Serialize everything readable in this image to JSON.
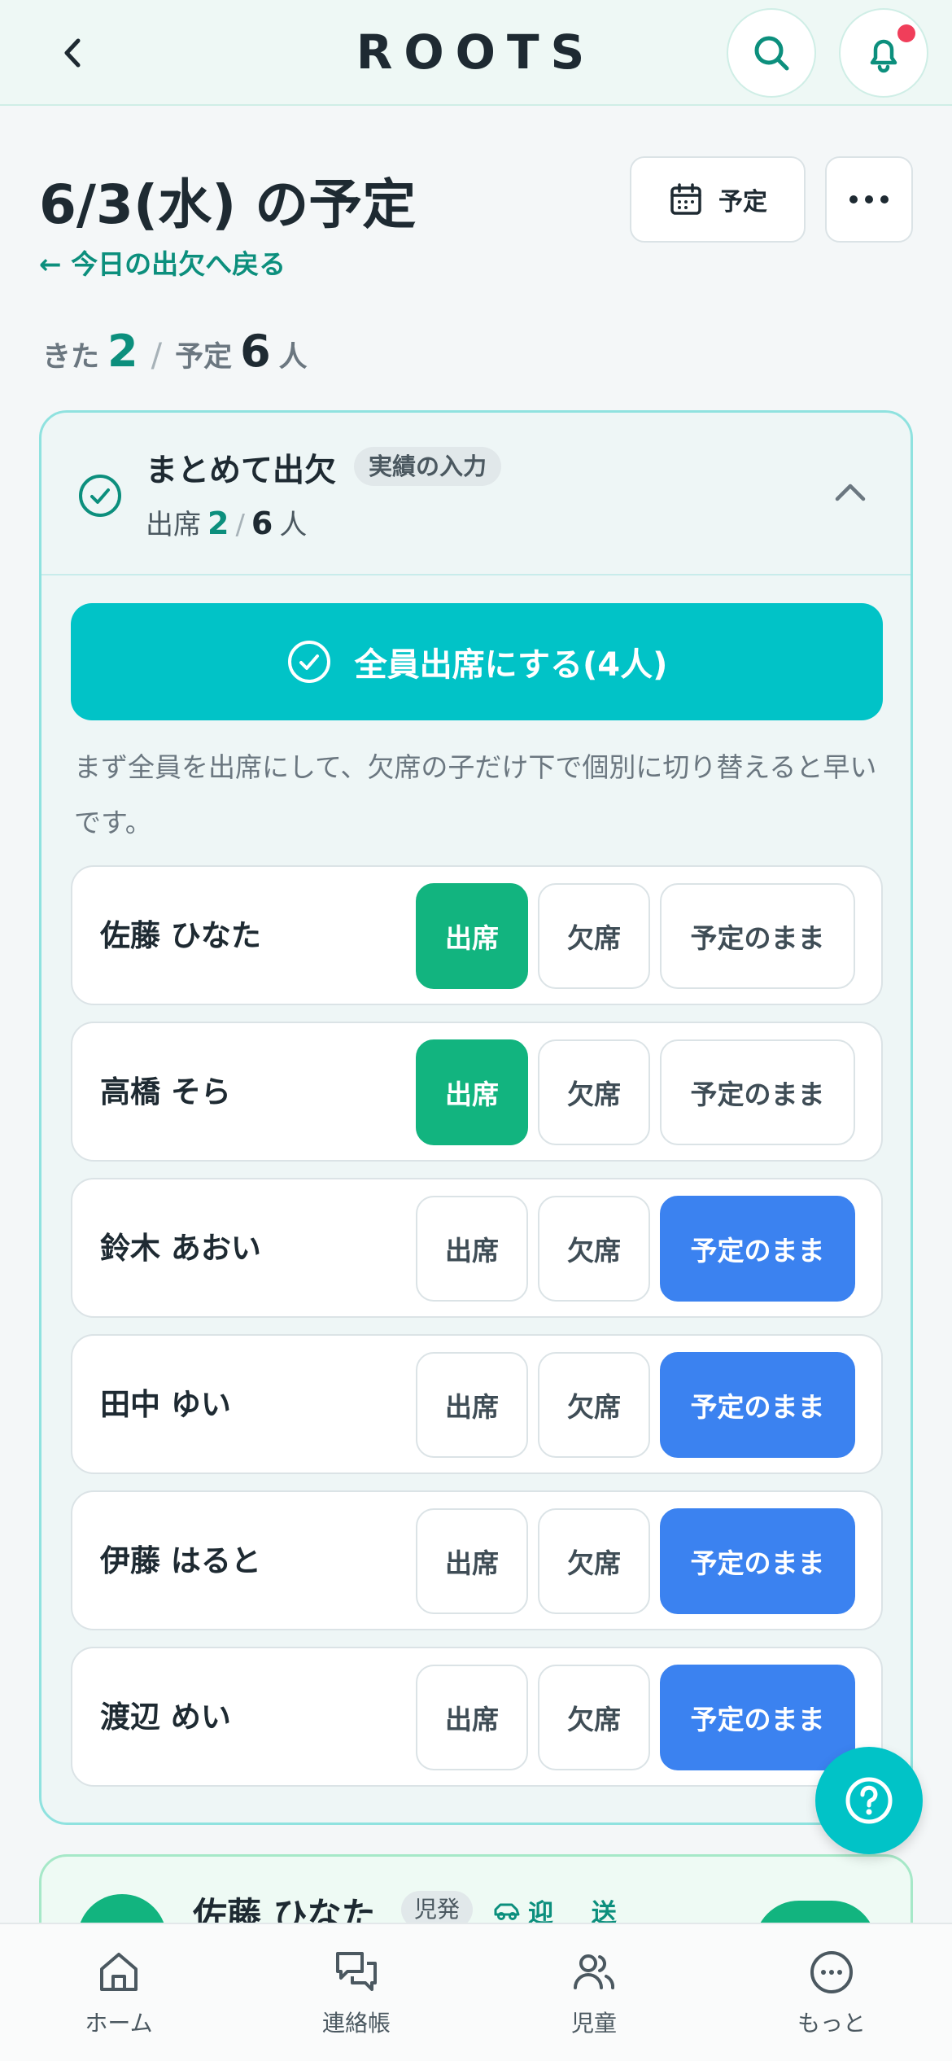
{
  "header": {
    "title": "ROOTS"
  },
  "page": {
    "title": "6/3(水) の予定",
    "back_link": "← 今日の出欠へ戻る",
    "schedule_button": "予定"
  },
  "summary": {
    "came_label": "きた",
    "came": "2",
    "separator": "/",
    "planned_label": "予定",
    "planned": "6",
    "unit": "人"
  },
  "bulk": {
    "title": "まとめて出欠",
    "tag": "実績の入力",
    "count_label": "出席",
    "present": "2",
    "separator": "/",
    "total": "6",
    "unit": "人",
    "all_present_button": "全員出席にする(4人)",
    "hint": "まず全員を出席にして、欠席の子だけ下で個別に切り替えると早いです。",
    "option_labels": {
      "present": "出席",
      "absent": "欠席",
      "keep": "予定のまま"
    },
    "rows": [
      {
        "name": "佐藤 ひなた",
        "selected": "present"
      },
      {
        "name": "高橋 そら",
        "selected": "present"
      },
      {
        "name": "鈴木 あおい",
        "selected": "keep"
      },
      {
        "name": "田中 ゆい",
        "selected": "keep"
      },
      {
        "name": "伊藤 はると",
        "selected": "keep"
      },
      {
        "name": "渡辺 めい",
        "selected": "keep"
      }
    ]
  },
  "next_card": {
    "name": "佐藤 ひなた",
    "tag": "児発",
    "pickup": "迎 送"
  },
  "nav": {
    "home": "ホーム",
    "contact": "連絡帳",
    "children": "児童",
    "more": "もっと"
  },
  "colors": {
    "teal": "#01c3c7",
    "green": "#12b47f",
    "blue": "#3b82f0",
    "accent_text": "#0c8f7d",
    "alert": "#f03e5a"
  }
}
